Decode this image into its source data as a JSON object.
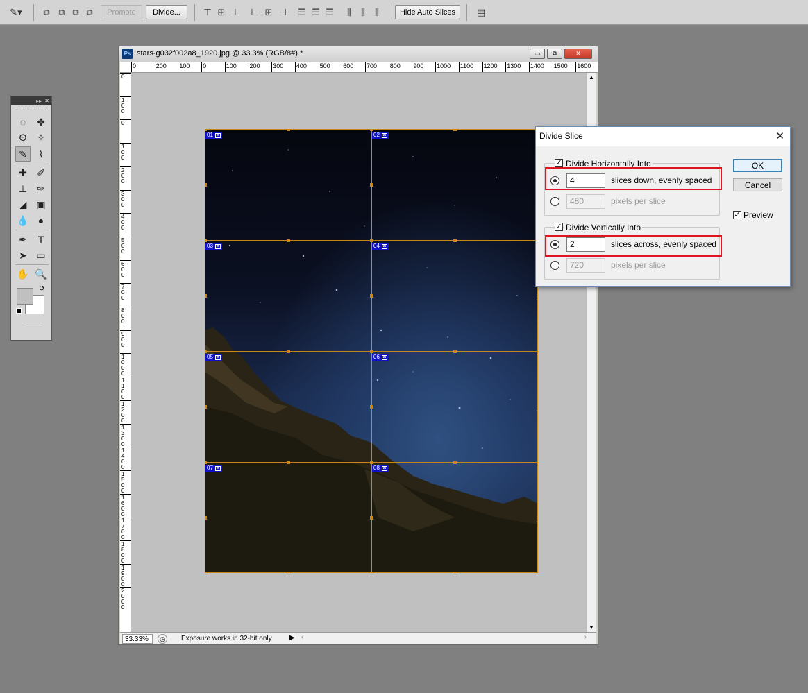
{
  "optionsbar": {
    "promote_label": "Promote",
    "divide_label": "Divide...",
    "hide_auto_slices_label": "Hide Auto Slices"
  },
  "document": {
    "title": "stars-g032f002a8_1920.jpg @ 33.3% (RGB/8#) *",
    "zoom": "33.33%",
    "status_text": "Exposure works in 32-bit only",
    "ruler_h_labels": [
      "0",
      "200",
      "100",
      "0",
      "100",
      "200",
      "300",
      "400",
      "500",
      "600",
      "700",
      "800",
      "900",
      "1000",
      "1100",
      "1200",
      "1300",
      "1400",
      "1500",
      "1600"
    ],
    "ruler_v_labels": [
      "0",
      "1 0 0",
      "0",
      "1 0 0",
      "2 0 0",
      "3 0 0",
      "4 0 0",
      "5 0 0",
      "6 0 0",
      "7 0 0",
      "8 0 0",
      "9 0 0",
      "1 0 0 0",
      "1 1 0 0",
      "1 2 0 0",
      "1 3 0 0",
      "1 4 0 0",
      "1 5 0 0",
      "1 6 0 0",
      "1 7 0 0",
      "1 8 0 0",
      "1 9 0 0",
      "2 0 0 0"
    ],
    "slices": [
      "01",
      "02",
      "03",
      "04",
      "05",
      "06",
      "07",
      "08"
    ]
  },
  "dialog": {
    "title": "Divide Slice",
    "horizontal": {
      "label": "Divide Horizontally Into",
      "count": "4",
      "count_text": "slices down, evenly spaced",
      "pixels": "480",
      "pixels_text": "pixels per slice"
    },
    "vertical": {
      "label": "Divide Vertically Into",
      "count": "2",
      "count_text": "slices across, evenly spaced",
      "pixels": "720",
      "pixels_text": "pixels per slice"
    },
    "ok_label": "OK",
    "cancel_label": "Cancel",
    "preview_label": "Preview"
  },
  "colors": {
    "slice_line": "#c8861a",
    "slice_badge": "#1010c8",
    "highlight": "#e0141e"
  }
}
